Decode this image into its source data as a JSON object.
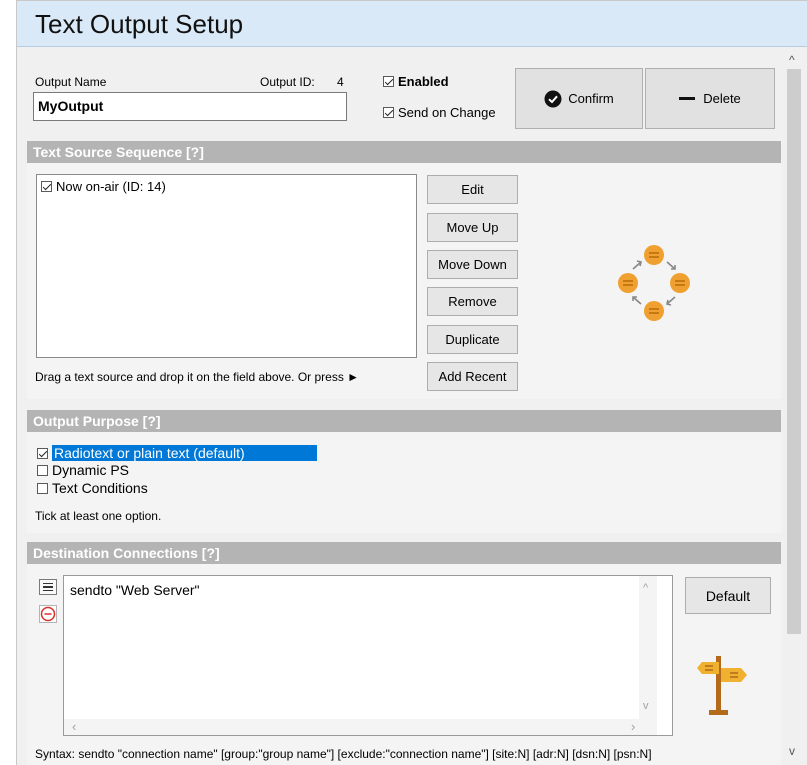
{
  "window": {
    "title": "Text Output Setup"
  },
  "output": {
    "name_label": "Output Name",
    "name_value": "MyOutput",
    "id_label": "Output ID:",
    "id_value": "4",
    "enabled_label": "Enabled",
    "enabled_checked": true,
    "send_on_change_label": "Send on Change",
    "send_on_change_checked": true,
    "confirm_label": "Confirm",
    "delete_label": "Delete"
  },
  "text_source": {
    "header": "Text Source Sequence [?]",
    "items": [
      {
        "label": "Now on-air (ID: 14)",
        "checked": true
      }
    ],
    "buttons": {
      "edit": "Edit",
      "move_up": "Move Up",
      "move_down": "Move Down",
      "remove": "Remove",
      "duplicate": "Duplicate",
      "add_recent": "Add Recent"
    },
    "hint": "Drag a text source and drop it on the field above. Or press ►",
    "icon": "cycle-icon"
  },
  "output_purpose": {
    "header": "Output Purpose [?]",
    "options": [
      {
        "label": "Radiotext or plain text (default)",
        "checked": true,
        "selected": true
      },
      {
        "label": "Dynamic PS",
        "checked": false
      },
      {
        "label": "Text Conditions",
        "checked": false
      }
    ],
    "hint": "Tick at least one option."
  },
  "destination": {
    "header": "Destination Connections [?]",
    "text": "sendto \"Web Server\"",
    "default_label": "Default",
    "syntax": "Syntax: sendto \"connection name\" [group:\"group name\"] [exclude:\"connection name\"] [site:N] [adr:N] [dsn:N] [psn:N]",
    "icons": [
      "comment-icon",
      "minus-circle-icon",
      "signpost-icon"
    ]
  },
  "colors": {
    "title_bg": "#d9e9f7",
    "section_bg": "#b4b4b4",
    "accent": "#f0a030",
    "selection": "#0078d7"
  }
}
